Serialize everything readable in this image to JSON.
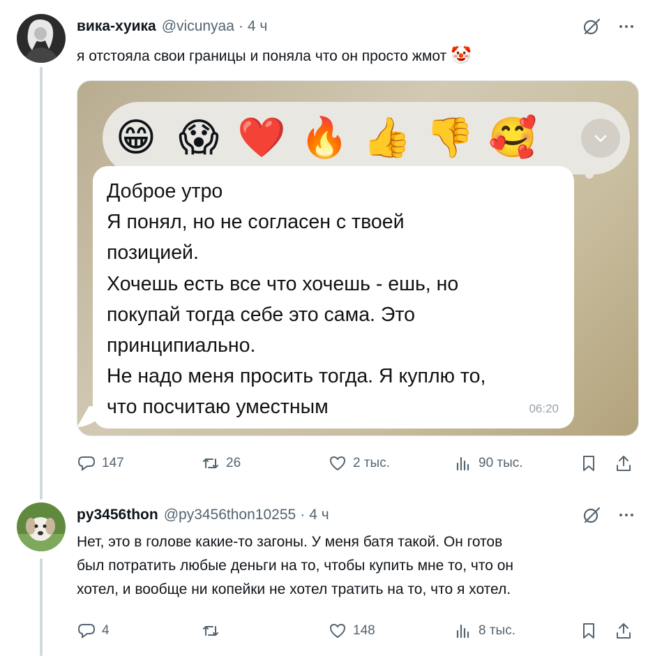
{
  "tweets": [
    {
      "name": "вика-хуика",
      "handle": "@vicunyaa",
      "dot": "·",
      "time": "4 ч",
      "text": "я отстояла свои границы и поняла что он просто жмот",
      "text_emoji": "🤡",
      "media": {
        "reactions": [
          "😁",
          "😱",
          "❤️",
          "🔥",
          "👍",
          "👎",
          "🥰"
        ],
        "message_lines": [
          "Доброе утро",
          "Я понял, но не согласен с твоей",
          "позицией.",
          "Хочешь есть все что хочешь - ешь, но",
          "покупай тогда себе это сама. Это",
          "принципиально.",
          "Не надо меня просить тогда. Я куплю то,",
          "что посчитаю уместным"
        ],
        "message_time": "06:20"
      },
      "stats": {
        "replies": "147",
        "retweets": "26",
        "likes": "2 тыс.",
        "views": "90 тыс."
      }
    },
    {
      "name": "py3456thon",
      "handle": "@py3456thon10255",
      "dot": "·",
      "time": "4 ч",
      "text_lines": [
        "Нет, это в голове какие-то загоны. У меня батя такой. Он готов",
        "был потратить любые деньги на то, чтобы купить мне то, что он",
        "хотел, и вообще ни копейки не хотел тратить на то, что я хотел."
      ],
      "stats": {
        "replies": "4",
        "retweets": "",
        "likes": "148",
        "views": "8 тыс."
      }
    }
  ],
  "icons": {
    "grok": "grok-icon",
    "more": "more-icon",
    "reply": "reply-icon",
    "retweet": "retweet-icon",
    "like": "like-icon",
    "views": "views-icon",
    "bookmark": "bookmark-icon",
    "share": "share-icon",
    "chevron": "chevron-down-icon"
  },
  "colors": {
    "muted": "#536471",
    "text": "#0f1419",
    "divider": "#eff3f4"
  }
}
